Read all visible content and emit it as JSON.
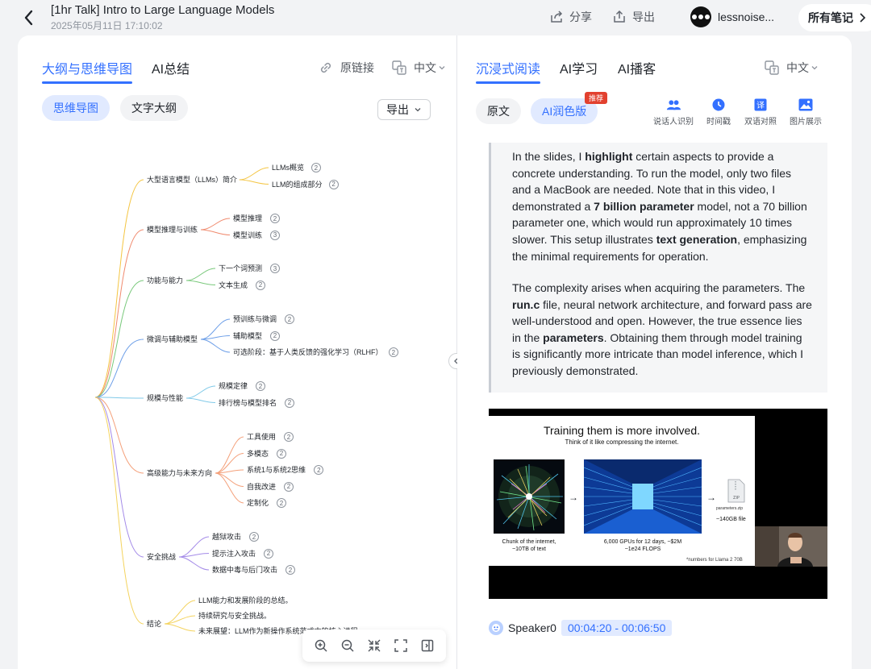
{
  "header": {
    "title": "[1hr Talk] Intro to Large Language Models",
    "date": "2025年05月11日 17:10:02",
    "share_label": "分享",
    "export_label": "导出",
    "username": "lessnoise...",
    "all_notes_label": "所有笔记"
  },
  "left": {
    "tabs": [
      "大纲与思维导图",
      "AI总结"
    ],
    "source_link": "原链接",
    "language": "中文",
    "modes": [
      "思维导图",
      "文字大纲"
    ],
    "export_label": "导出",
    "mindmap": {
      "branches": [
        {
          "label": "大型语言模型（LLMs）简介",
          "color": "#f4c542",
          "children": [
            {
              "label": "LLMs概览",
              "badge": "2"
            },
            {
              "label": "LLM的组成部分",
              "badge": "2"
            }
          ]
        },
        {
          "label": "模型推理与训练",
          "color": "#f08a6e",
          "children": [
            {
              "label": "模型推理",
              "badge": "2"
            },
            {
              "label": "模型训练",
              "badge": "3"
            }
          ]
        },
        {
          "label": "功能与能力",
          "color": "#78c87a",
          "children": [
            {
              "label": "下一个词预测",
              "badge": "3"
            },
            {
              "label": "文本生成",
              "badge": "2"
            }
          ]
        },
        {
          "label": "微调与辅助模型",
          "color": "#6fa0e8",
          "children": [
            {
              "label": "预训练与微调",
              "badge": "2"
            },
            {
              "label": "辅助模型",
              "badge": "2"
            },
            {
              "label": "可选阶段：基于人类反馈的强化学习（RLHF）",
              "badge": "2"
            }
          ]
        },
        {
          "label": "规模与性能",
          "color": "#7fc9e8",
          "children": [
            {
              "label": "规模定律",
              "badge": "2"
            },
            {
              "label": "排行榜与模型排名",
              "badge": "2"
            }
          ]
        },
        {
          "label": "高级能力与未来方向",
          "color": "#f4a07a",
          "children": [
            {
              "label": "工具使用",
              "badge": "2"
            },
            {
              "label": "多模态",
              "badge": "2"
            },
            {
              "label": "系统1与系统2思维",
              "badge": "2"
            },
            {
              "label": "自我改进",
              "badge": "2"
            },
            {
              "label": "定制化",
              "badge": "2"
            }
          ]
        },
        {
          "label": "安全挑战",
          "color": "#a48be8",
          "children": [
            {
              "label": "越狱攻击",
              "badge": "2"
            },
            {
              "label": "提示注入攻击",
              "badge": "2"
            },
            {
              "label": "数据中毒与后门攻击",
              "badge": "2"
            }
          ]
        },
        {
          "label": "结论",
          "color": "#f4d35e",
          "children": [
            {
              "label": "LLM能力和发展阶段的总结。",
              "badge": ""
            },
            {
              "label": "持续研究与安全挑战。",
              "badge": ""
            },
            {
              "label": "未来展望：LLM作为新操作系统范式中的核心进程。",
              "badge": ""
            }
          ]
        }
      ]
    }
  },
  "right": {
    "tabs": [
      "沉浸式阅读",
      "AI学习",
      "AI播客"
    ],
    "language": "中文",
    "modes": [
      "原文",
      "AI润色版"
    ],
    "recommend_badge": "推荐",
    "tools": [
      "说话人识别",
      "时间戳",
      "双语对照",
      "图片展示"
    ],
    "para1": [
      {
        "t": "In the slides, I ",
        "b": false
      },
      {
        "t": "highlight",
        "b": true
      },
      {
        "t": " certain aspects to provide a concrete understanding. To run the model, only two files and a MacBook are needed. Note that in this video, I demonstrated a ",
        "b": false
      },
      {
        "t": "7 billion parameter",
        "b": true
      },
      {
        "t": " model, not a 70 billion parameter one, which would run approximately 10 times slower. This setup illustrates ",
        "b": false
      },
      {
        "t": "text generation",
        "b": true
      },
      {
        "t": ", emphasizing the minimal requirements for operation.",
        "b": false
      }
    ],
    "para2": [
      {
        "t": "The complexity arises when acquiring the parameters. The ",
        "b": false
      },
      {
        "t": "run.c",
        "b": true
      },
      {
        "t": " file, neural network architecture, and forward pass are well-understood and open. However, the true essence lies in the ",
        "b": false
      },
      {
        "t": "parameters",
        "b": true
      },
      {
        "t": ". Obtaining them through model training is significantly more intricate than model inference, which I previously demonstrated.",
        "b": false
      }
    ],
    "slide": {
      "title": "Training them is more involved.",
      "subtitle": "Think of it like compressing the internet.",
      "caption1": "Chunk of the internet,",
      "caption1b": "~10TB of text",
      "caption2": "6,000 GPUs for 12 days, ~$2M",
      "caption2b": "~1e24 FLOPS",
      "file_label": "parameters.zip",
      "caption3": "~140GB file",
      "footnote": "*numbers for Llama 2 70B"
    },
    "speaker": "Speaker0",
    "time_range": "00:04:20 - 00:06:50"
  }
}
